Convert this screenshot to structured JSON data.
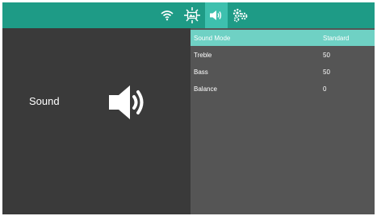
{
  "tabs": [
    {
      "icon": "wifi-icon",
      "active": false
    },
    {
      "icon": "display-settings-icon",
      "active": false
    },
    {
      "icon": "sound-icon",
      "active": true
    },
    {
      "icon": "system-settings-icon",
      "active": false
    }
  ],
  "left_panel": {
    "title": "Sound",
    "icon": "speaker-icon"
  },
  "settings": [
    {
      "label": "Sound Mode",
      "value": "Standard",
      "selected": true
    },
    {
      "label": "Treble",
      "value": "50",
      "selected": false
    },
    {
      "label": "Bass",
      "value": "50",
      "selected": false
    },
    {
      "label": "Balance",
      "value": "0",
      "selected": false
    }
  ],
  "colors": {
    "topbar": "#1e9b86",
    "active_tab": "#3ec0ae",
    "selected_row": "#6fd1c4",
    "left_panel": "#3a3a3a",
    "right_panel": "#555555"
  }
}
